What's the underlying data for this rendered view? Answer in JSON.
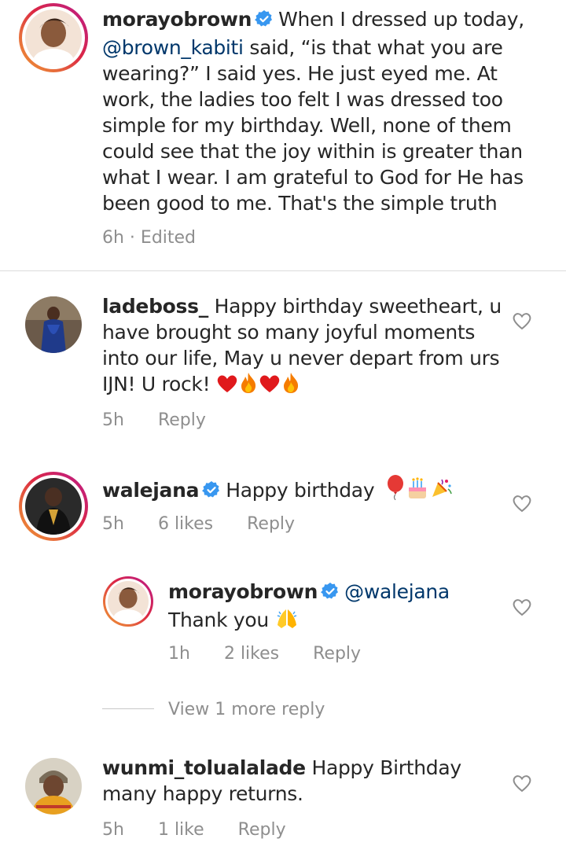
{
  "comments": [
    {
      "username": "morayobrown",
      "verified": true,
      "text_parts": [
        "When I dressed up today, ",
        "@brown_kabiti",
        " said, “is that what you are wearing?” I said yes. He just eyed me. At work, the ladies too felt I was dressed too simple for my birthday. Well, none of them could see that the joy within is greater than what I wear. I am grateful to God for He has been good to me. That's the simple truth"
      ],
      "meta": "6h · Edited"
    },
    {
      "username": "ladeboss_",
      "verified": false,
      "text": "Happy birthday sweetheart, u have brought so many joyful moments into our life, May u never depart from urs IJN! U rock!",
      "time": "5h",
      "reply": "Reply"
    },
    {
      "username": "walejana",
      "verified": true,
      "text": "Happy birthday",
      "time": "5h",
      "likes": "6 likes",
      "reply": "Reply"
    },
    {
      "username": "morayobrown",
      "verified": true,
      "mention": "@walejana",
      "text": "Thank you",
      "time": "1h",
      "likes": "2 likes",
      "reply": "Reply"
    },
    {
      "username": "wunmi_tolualalade",
      "verified": false,
      "text": "Happy Birthday many happy returns.",
      "time": "5h",
      "likes": "1 like",
      "reply": "Reply"
    }
  ],
  "view_more": "View 1 more reply",
  "colors": {
    "link": "#00376b",
    "meta": "#8e8e8e",
    "verified": "#3897f0",
    "heart_emoji": "#e0191c"
  }
}
